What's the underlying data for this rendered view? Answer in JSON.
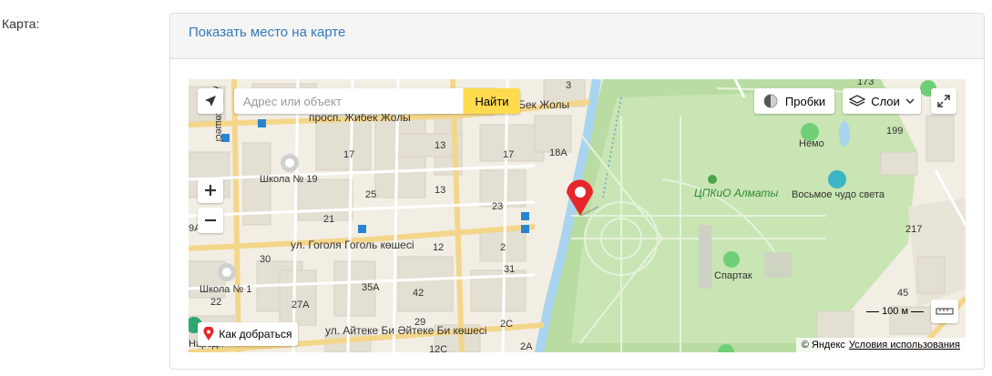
{
  "field": {
    "label": "Карта:"
  },
  "panel": {
    "link_text": "Показать место на карте"
  },
  "map": {
    "search_placeholder": "Адрес или объект",
    "find_button": "Найти",
    "traffic_button": "Пробки",
    "layers_button": "Слои",
    "route_button": "Как добраться",
    "scale_label": "100 м",
    "copyright": "© Яндекс",
    "terms_link": "Условия использования",
    "icons": [
      "locate-icon",
      "zoom-in-icon",
      "zoom-out-icon",
      "traffic-icon",
      "layers-icon",
      "chevron-down-icon",
      "fullscreen-icon",
      "ruler-icon",
      "placemark-icon"
    ],
    "labels": {
      "street1": "просп. Жибек Жолы",
      "street1b": "Бек Жолы",
      "street2": "ул. Гоголя Гоголь көшесі",
      "street3": "ул. Айтеке Би Әйтеке Би көшесі",
      "street_vert": "дайқ көшесі",
      "school19": "Школа № 19",
      "school1": "Школа № 1",
      "park": "ЦПКиО Алматы",
      "nemo": "Немо",
      "wonder": "Восьмое чудо света",
      "spartak": "Спартак",
      "nar": "Народн",
      "n3": "3",
      "n13a": "13",
      "n13b": "13",
      "n17a": "17",
      "n17b": "17",
      "n18a": "18А",
      "n25": "25",
      "n23": "23",
      "n21": "21",
      "n12": "12",
      "n2": "2",
      "n31": "31",
      "n30": "30",
      "n35a": "35А",
      "n42": "42",
      "n27a": "27А",
      "n22": "22",
      "n29": "29",
      "n2c": "2С",
      "n2a": "2А",
      "n12c": "12С",
      "n9a": "9А",
      "n173": "173",
      "n199": "199",
      "n217": "217",
      "n45": "45"
    }
  }
}
